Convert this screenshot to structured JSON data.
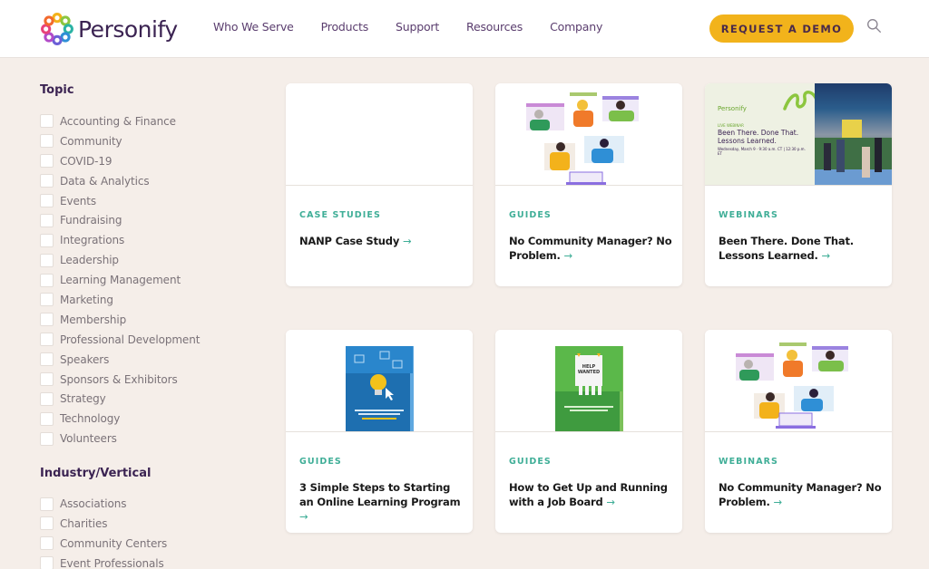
{
  "header": {
    "brand": "Personify",
    "nav": [
      "Who We Serve",
      "Products",
      "Support",
      "Resources",
      "Company"
    ],
    "cta_label": "REQUEST A DEMO",
    "search_label": "Search"
  },
  "colors": {
    "brand_purple": "#3b2352",
    "cta_yellow": "#f2b31b",
    "tag_teal": "#3fae97",
    "page_bg": "#f5eee9"
  },
  "sidebar": {
    "topic": {
      "title": "Topic",
      "items": [
        "Accounting & Finance",
        "Community",
        "COVID-19",
        "Data & Analytics",
        "Events",
        "Fundraising",
        "Integrations",
        "Leadership",
        "Learning Management",
        "Marketing",
        "Membership",
        "Professional Development",
        "Speakers",
        "Sponsors & Exhibitors",
        "Strategy",
        "Technology",
        "Volunteers"
      ]
    },
    "industry": {
      "title": "Industry/Vertical",
      "items": [
        "Associations",
        "Charities",
        "Community Centers",
        "Event Professionals"
      ]
    }
  },
  "cards": [
    {
      "tag": "CASE STUDIES",
      "title": "NANP Case Study",
      "image": "blank"
    },
    {
      "tag": "GUIDES",
      "title": "No Community Manager? No Problem.",
      "image": "community-illustration"
    },
    {
      "tag": "WEBINARS",
      "title": "Been There. Done That. Lessons Learned.",
      "image": "webinar-promo",
      "promo": {
        "brand": "Personify",
        "kicker": "LIVE WEBINAR",
        "title": "Been There. Done That. Lessons Learned.",
        "date": "Wednesday, March 9 · 9:30 a.m. CT | 12:30 p.m. ET"
      }
    },
    {
      "tag": "GUIDES",
      "title": "3 Simple Steps to Starting an Online Learning Program",
      "image": "blue-ebook-cover"
    },
    {
      "tag": "GUIDES",
      "title": "How to Get Up and Running with a Job Board",
      "image": "green-ebook-cover",
      "cover_text": "HELP WANTED"
    },
    {
      "tag": "WEBINARS",
      "title": "No Community Manager? No Problem.",
      "image": "community-illustration"
    }
  ],
  "arrow": "→"
}
